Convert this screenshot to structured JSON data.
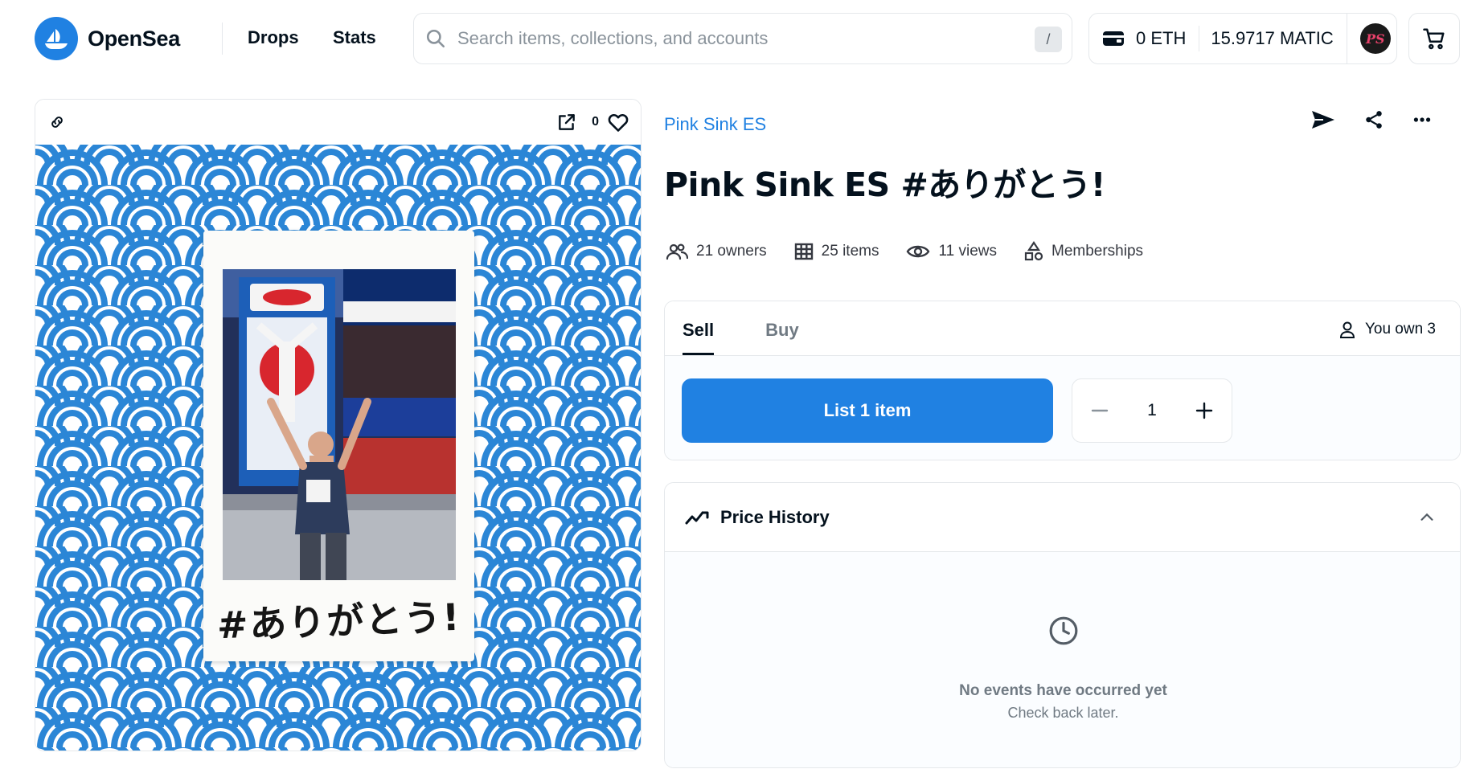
{
  "header": {
    "logo_text": "OpenSea",
    "nav": [
      {
        "label": "Drops"
      },
      {
        "label": "Stats"
      }
    ],
    "search": {
      "placeholder": "Search items, collections, and accounts",
      "shortcut": "/"
    },
    "wallet": {
      "eth_balance": "0 ETH",
      "matic_balance": "15.9717 MATIC",
      "avatar_initials": "PS"
    }
  },
  "media": {
    "favorite_count": "0",
    "caption": "#ありがとう!",
    "colors": {
      "wave": "#2b86d6",
      "background": "#ffffff"
    }
  },
  "item": {
    "collection": "Pink Sink ES",
    "title": "Pink Sink ES #ありがとう!",
    "stats": {
      "owners": "21 owners",
      "items": "25 items",
      "views": "11 views",
      "category": "Memberships"
    }
  },
  "trade": {
    "tabs": [
      {
        "label": "Sell"
      },
      {
        "label": "Buy"
      }
    ],
    "active_tab": "Sell",
    "you_own": "You own 3",
    "list_button": "List 1 item",
    "quantity": "1"
  },
  "price_history": {
    "title": "Price History",
    "empty_title": "No events have occurred yet",
    "empty_subtitle": "Check back later."
  },
  "colors": {
    "accent": "#2081e2",
    "text": "#04111d",
    "muted": "#707a83",
    "border": "#e5e8eb"
  }
}
